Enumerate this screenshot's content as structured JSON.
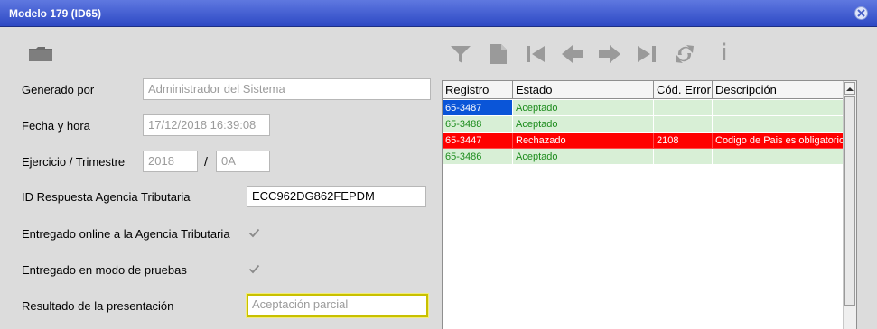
{
  "window": {
    "title": "Modelo 179 (ID65)"
  },
  "form": {
    "generado_por": {
      "label": "Generado por",
      "value": "Administrador del Sistema"
    },
    "fecha_hora": {
      "label": "Fecha y hora",
      "value": "17/12/2018  16:39:08"
    },
    "ejercicio": {
      "label": "Ejercicio / Trimestre",
      "year": "2018",
      "separator": "/",
      "quarter": "0A"
    },
    "id_respuesta": {
      "label": "ID Respuesta Agencia Tributaria",
      "value": "ECC962DG862FEPDM"
    },
    "entregado_online": {
      "label": "Entregado online a la Agencia Tributaria",
      "checked": true
    },
    "entregado_pruebas": {
      "label": "Entregado en modo de pruebas",
      "checked": true
    },
    "resultado": {
      "label": "Resultado de la presentación",
      "value": "Aceptación parcial"
    }
  },
  "toolbar": {
    "icons": [
      "filter-icon",
      "document-icon",
      "first-record-icon",
      "previous-record-icon",
      "next-record-icon",
      "last-record-icon",
      "refresh-icon",
      "info-icon"
    ],
    "info_label": "i",
    "folder_icon": "folder-icon"
  },
  "grid": {
    "columns": [
      "Registro",
      "Estado",
      "Cód. Error",
      "Descripción"
    ],
    "rows": [
      {
        "registro": "65-3487",
        "estado": "Aceptado",
        "codigo": "",
        "descripcion": "",
        "status": "accepted",
        "selected": true
      },
      {
        "registro": "65-3488",
        "estado": "Aceptado",
        "codigo": "",
        "descripcion": "",
        "status": "accepted",
        "selected": false
      },
      {
        "registro": "65-3447",
        "estado": "Rechazado",
        "codigo": "2108",
        "descripcion": "Codigo de Pais es obligatorio c",
        "status": "rejected",
        "selected": false
      },
      {
        "registro": "65-3486",
        "estado": "Aceptado",
        "codigo": "",
        "descripcion": "",
        "status": "accepted",
        "selected": false
      }
    ],
    "colors": {
      "accepted_bg": "#d8efd6",
      "accepted_text": "#1d8c1d",
      "rejected_bg": "#ff0000",
      "rejected_text": "#ffffff",
      "selected_bg": "#0a55d8",
      "selected_text": "#ffffff"
    }
  }
}
